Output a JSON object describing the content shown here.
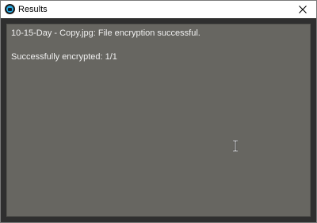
{
  "window": {
    "title": "Results",
    "icon": "app-icon",
    "close_icon": "close-icon"
  },
  "results": {
    "lines": [
      "10-15-Day - Copy.jpg: File encryption successful.",
      "",
      "Successfully encrypted: 1/1"
    ]
  },
  "colors": {
    "frame": "#2f2f2f",
    "textarea_bg": "#676661",
    "text": "#f0f0f0",
    "titlebar": "#ffffff"
  }
}
